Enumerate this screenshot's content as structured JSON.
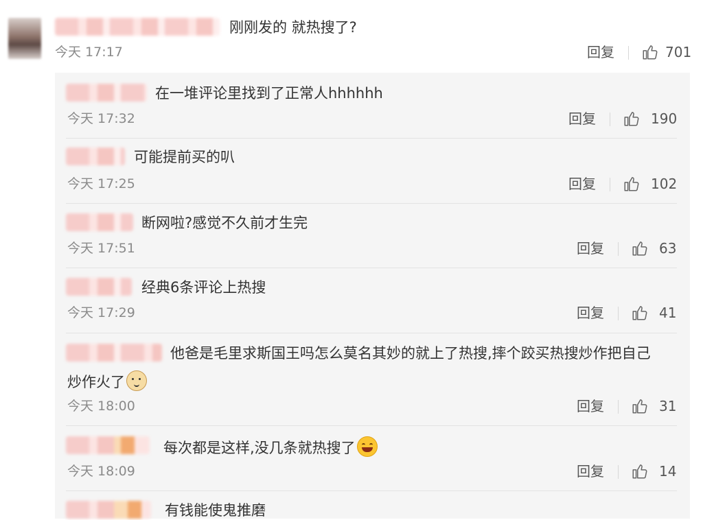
{
  "main_comment": {
    "text": "刚刚发的 就热搜了?",
    "time": "今天 17:17",
    "reply_label": "回复",
    "likes": "701"
  },
  "replies": [
    {
      "text": "在一堆评论里找到了正常人hhhhhh",
      "time": "今天 17:32",
      "reply_label": "回复",
      "likes": "190"
    },
    {
      "text": "可能提前买的叭",
      "time": "今天 17:25",
      "reply_label": "回复",
      "likes": "102"
    },
    {
      "text": "断网啦?感觉不久前才生完",
      "time": "今天 17:51",
      "reply_label": "回复",
      "likes": "63"
    },
    {
      "text": "经典6条评论上热搜",
      "time": "今天 17:29",
      "reply_label": "回复",
      "likes": "41"
    },
    {
      "text": "他爸是毛里求斯国王吗怎么莫名其妙的就上了热搜,摔个跤买热搜炒作把自己",
      "text_line2": "炒作火了",
      "emoji": "doge-icon",
      "time": "今天 18:00",
      "reply_label": "回复",
      "likes": "31"
    },
    {
      "text": "每次都是这样,没几条就热搜了",
      "emoji": "grin-icon",
      "time": "今天 18:09",
      "reply_label": "回复",
      "likes": "14"
    },
    {
      "text": "有钱能使鬼推磨"
    }
  ],
  "colors": {
    "background": "#ffffff",
    "thread_background": "#f5f5f5",
    "text": "#333333",
    "meta": "#8a8a8a"
  }
}
